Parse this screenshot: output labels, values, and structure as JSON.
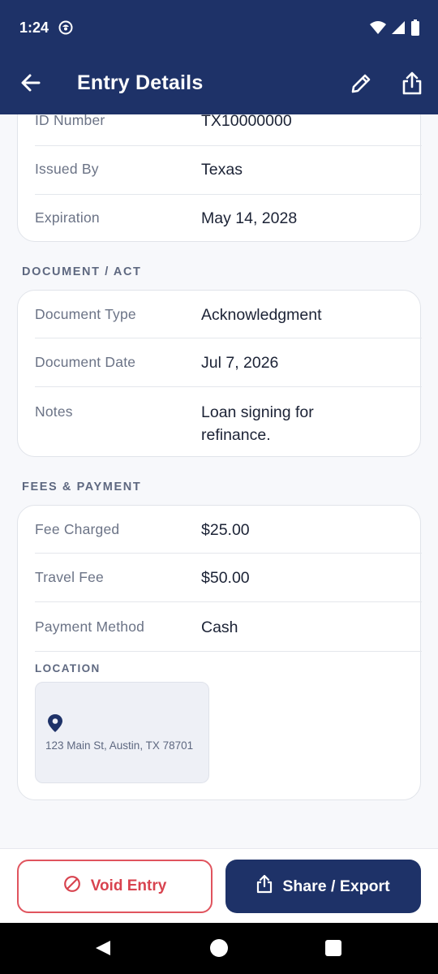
{
  "status_bar": {
    "time": "1:24"
  },
  "app_bar": {
    "title": "Entry Details"
  },
  "id_card": {
    "rows": [
      {
        "label": "ID Number",
        "value": "TX10000000"
      },
      {
        "label": "Issued By",
        "value": "Texas"
      },
      {
        "label": "Expiration",
        "value": "May 14, 2028"
      }
    ]
  },
  "document_section": {
    "title": "DOCUMENT / ACT",
    "rows": [
      {
        "label": "Document Type",
        "value": "Acknowledgment"
      },
      {
        "label": "Document Date",
        "value": "Jul 7, 2026"
      },
      {
        "label": "Notes",
        "value": "Loan signing for refinance."
      }
    ]
  },
  "fees_section": {
    "title": "FEES & PAYMENT",
    "rows": [
      {
        "label": "Fee Charged",
        "value": "$25.00"
      },
      {
        "label": "Travel Fee",
        "value": "$50.00"
      },
      {
        "label": "Payment Method",
        "value": "Cash"
      }
    ],
    "location_label": "LOCATION",
    "location_address": "123 Main St, Austin, TX 78701"
  },
  "actions": {
    "void_label": "Void Entry",
    "export_label": "Share / Export"
  },
  "colors": {
    "primary": "#1e3268",
    "danger": "#d8434f"
  },
  "icons": [
    "back-arrow-icon",
    "pencil-icon",
    "share-icon",
    "location-pin-icon",
    "ban-icon",
    "wifi-icon",
    "signal-icon",
    "battery-icon"
  ]
}
